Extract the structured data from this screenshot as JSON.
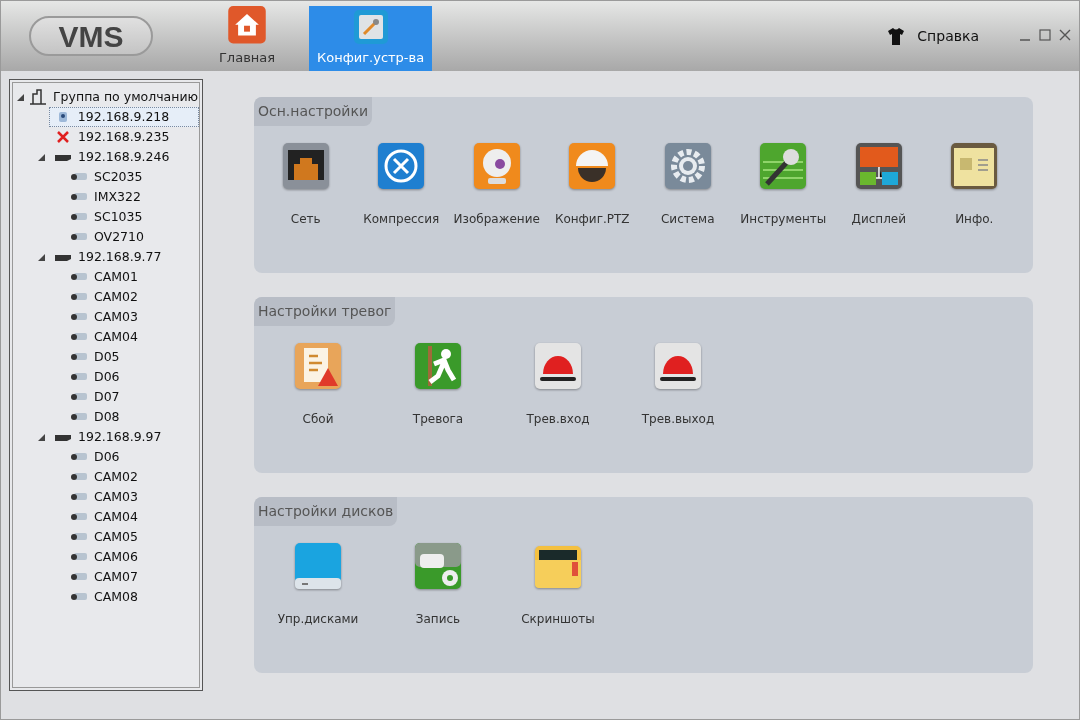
{
  "header": {
    "logo": "VMS",
    "tabs": [
      {
        "label": "Главная",
        "kind": "home",
        "selected": false
      },
      {
        "label": "Конфиг.устр-ва",
        "kind": "config",
        "selected": true
      }
    ],
    "help": "Справка"
  },
  "tree": [
    {
      "label": "Группа по умолчанию",
      "kind": "group",
      "expanded": true,
      "selected": false,
      "children": [
        {
          "label": "192.168.9.218",
          "kind": "device",
          "online": true,
          "selected": true
        },
        {
          "label": "192.168.9.235",
          "kind": "device",
          "online": false,
          "selected": false
        },
        {
          "label": "192.168.9.246",
          "kind": "nvr",
          "expanded": true,
          "selected": false,
          "children": [
            {
              "label": "SC2035",
              "kind": "camera",
              "selected": false
            },
            {
              "label": "IMX322",
              "kind": "camera",
              "selected": false
            },
            {
              "label": "SC1035",
              "kind": "camera",
              "selected": false
            },
            {
              "label": "OV2710",
              "kind": "camera",
              "selected": false
            }
          ]
        },
        {
          "label": "192.168.9.77",
          "kind": "nvr",
          "expanded": true,
          "selected": false,
          "children": [
            {
              "label": "CAM01",
              "kind": "camera",
              "selected": false
            },
            {
              "label": "CAM02",
              "kind": "camera",
              "selected": false
            },
            {
              "label": "CAM03",
              "kind": "camera",
              "selected": false
            },
            {
              "label": "CAM04",
              "kind": "camera",
              "selected": false
            },
            {
              "label": "D05",
              "kind": "camera",
              "selected": false
            },
            {
              "label": "D06",
              "kind": "camera",
              "selected": false
            },
            {
              "label": "D07",
              "kind": "camera",
              "selected": false
            },
            {
              "label": "D08",
              "kind": "camera",
              "selected": false
            }
          ]
        },
        {
          "label": "192.168.9.97",
          "kind": "nvr",
          "expanded": true,
          "selected": false,
          "children": [
            {
              "label": "D06",
              "kind": "camera",
              "selected": false
            },
            {
              "label": "CAM02",
              "kind": "camera",
              "selected": false
            },
            {
              "label": "CAM03",
              "kind": "camera",
              "selected": false
            },
            {
              "label": "CAM04",
              "kind": "camera",
              "selected": false
            },
            {
              "label": "CAM05",
              "kind": "camera",
              "selected": false
            },
            {
              "label": "CAM06",
              "kind": "camera",
              "selected": false
            },
            {
              "label": "CAM07",
              "kind": "camera",
              "selected": false
            },
            {
              "label": "CAM08",
              "kind": "camera",
              "selected": false
            }
          ]
        }
      ]
    }
  ],
  "sections": [
    {
      "title": "Осн.настройки",
      "items": [
        {
          "label": "Сеть",
          "kind": "network"
        },
        {
          "label": "Компрессия",
          "kind": "compression"
        },
        {
          "label": "Изображение",
          "kind": "image"
        },
        {
          "label": "Конфиг.PTZ",
          "kind": "ptz"
        },
        {
          "label": "Система",
          "kind": "system"
        },
        {
          "label": "Инструменты",
          "kind": "tools"
        },
        {
          "label": "Дисплей",
          "kind": "display"
        },
        {
          "label": "Инфо.",
          "kind": "info"
        }
      ]
    },
    {
      "title": "Настройки тревог",
      "items": [
        {
          "label": "Сбой",
          "kind": "fault"
        },
        {
          "label": "Тревога",
          "kind": "alarm"
        },
        {
          "label": "Трев.вход",
          "kind": "siren"
        },
        {
          "label": "Трев.выход",
          "kind": "siren"
        }
      ]
    },
    {
      "title": "Настройки дисков",
      "items": [
        {
          "label": "Упр.дисками",
          "kind": "disk"
        },
        {
          "label": "Запись",
          "kind": "record"
        },
        {
          "label": "Скриншоты",
          "kind": "screenshot"
        }
      ]
    }
  ]
}
